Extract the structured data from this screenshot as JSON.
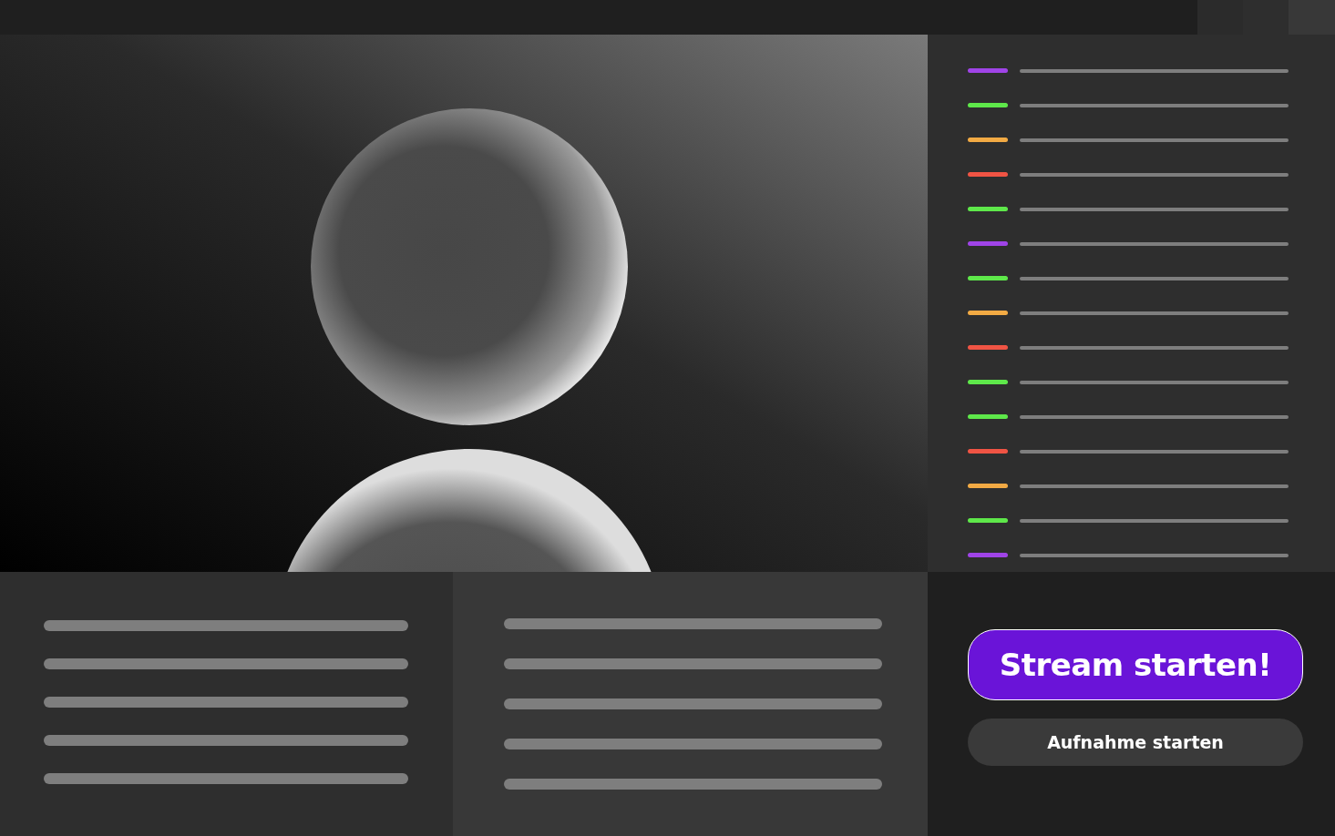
{
  "chat": [
    {
      "color": "#a044e8"
    },
    {
      "color": "#5ee84a"
    },
    {
      "color": "#f2aa44"
    },
    {
      "color": "#f05444"
    },
    {
      "color": "#5ee84a"
    },
    {
      "color": "#a044e8"
    },
    {
      "color": "#5ee84a"
    },
    {
      "color": "#f2aa44"
    },
    {
      "color": "#f05444"
    },
    {
      "color": "#5ee84a"
    },
    {
      "color": "#5ee84a"
    },
    {
      "color": "#f05444"
    },
    {
      "color": "#f2aa44"
    },
    {
      "color": "#5ee84a"
    },
    {
      "color": "#a044e8"
    }
  ],
  "buttons": [
    {
      "label": "Stream starten!",
      "kind": "primary"
    },
    {
      "label": "Aufnahme starten",
      "kind": "secondary"
    }
  ]
}
